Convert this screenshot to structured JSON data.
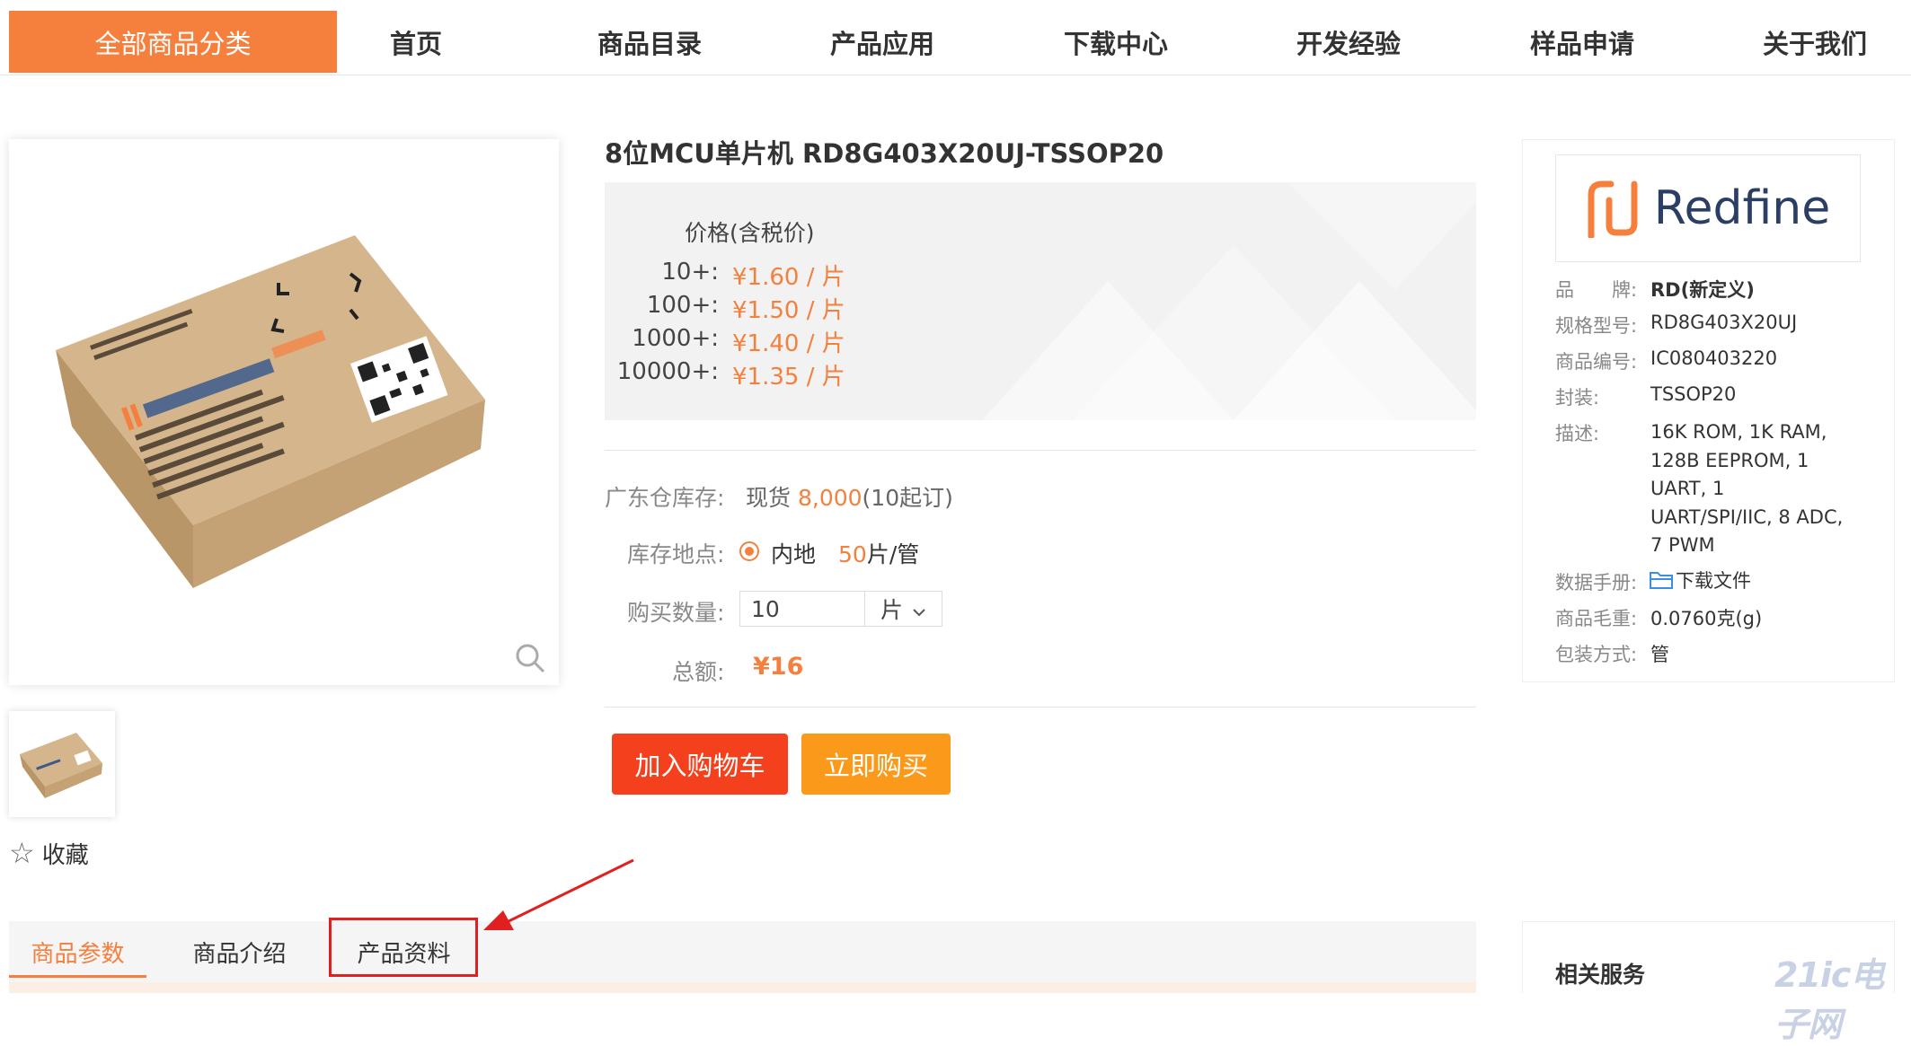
{
  "nav": {
    "category_button": "全部商品分类",
    "items": [
      "首页",
      "商品目录",
      "产品应用",
      "下载中心",
      "开发经验",
      "样品申请",
      "关于我们"
    ]
  },
  "product": {
    "title": "8位MCU单片机 RD8G403X20UJ-TSSOP20",
    "favorite": "收藏",
    "price_label": "价格(含税价)",
    "tiers": [
      {
        "qty": "10+:",
        "price": "¥1.60 / 片"
      },
      {
        "qty": "100+:",
        "price": "¥1.50 / 片"
      },
      {
        "qty": "1000+:",
        "price": "¥1.40 / 片"
      },
      {
        "qty": "10000+:",
        "price": "¥1.35 / 片"
      }
    ],
    "stock": {
      "label": "广东仓库存:",
      "prefix": "现货",
      "amount": "8,000",
      "suffix": "(10起订)"
    },
    "location": {
      "label": "库存地点:",
      "option": "内地",
      "pack_qty": "50",
      "pack_unit": "片/管"
    },
    "quantity": {
      "label": "购买数量:",
      "value": "10",
      "unit": "片"
    },
    "total": {
      "label": "总额:",
      "value": "¥16"
    },
    "buttons": {
      "add_to_cart": "加入购物车",
      "buy_now": "立即购买"
    }
  },
  "spec_panel": {
    "logo_text": "Redfine",
    "rows": [
      {
        "label": "品　　牌:",
        "value": "RD(新定义)"
      },
      {
        "label": "规格型号:",
        "value": "RD8G403X20UJ"
      },
      {
        "label": "商品编号:",
        "value": "IC080403220"
      },
      {
        "label": "封装:",
        "value": "TSSOP20"
      },
      {
        "label": "描述:",
        "value": "16K ROM, 1K RAM, 128B EEPROM, 1 UART, 1 UART/SPI/IIC, 8 ADC, 7 PWM"
      },
      {
        "label": "数据手册:",
        "value": "下载文件"
      },
      {
        "label": "商品毛重:",
        "value": "0.0760克(g)"
      },
      {
        "label": "包装方式:",
        "value": "管"
      }
    ]
  },
  "tabs": [
    "商品参数",
    "商品介绍",
    "产品资料"
  ],
  "related_services": "相关服务",
  "watermark": "21ic电子网",
  "colors": {
    "accent": "#f5803e",
    "cart_button": "#f4401d",
    "buy_button": "#fb9a1a",
    "highlight": "#e02020"
  }
}
